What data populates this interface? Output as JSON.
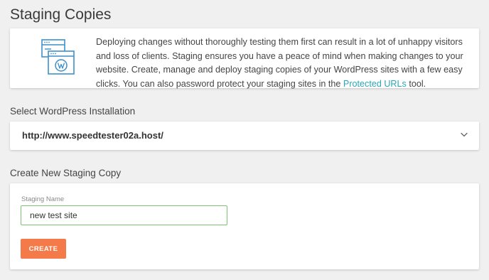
{
  "page": {
    "title": "Staging Copies"
  },
  "intro": {
    "icon": "browser-windows-wordpress-icon",
    "text_before_link": "Deploying changes without thoroughly testing them first can result in a lot of unhappy visitors and loss of clients. Staging ensures you have a peace of mind when making changes to your website. Create, manage and deploy staging copies of your WordPress sites with a few easy clicks. You can also password protect your staging sites in the ",
    "link_text": "Protected URLs",
    "text_after_link": " tool."
  },
  "select_installation": {
    "label": "Select WordPress Installation",
    "selected_value": "http://www.speedtester02a.host/",
    "icon": "chevron-down-icon"
  },
  "create_staging": {
    "section_label": "Create New Staging Copy",
    "field_label": "Staging Name",
    "field_value": "new test site",
    "button_label": "CREATE"
  },
  "colors": {
    "accent_link": "#2aa7b8",
    "button": "#f47a4a",
    "input_focus_border": "#7cc474",
    "icon_blue": "#3d8fc9"
  }
}
